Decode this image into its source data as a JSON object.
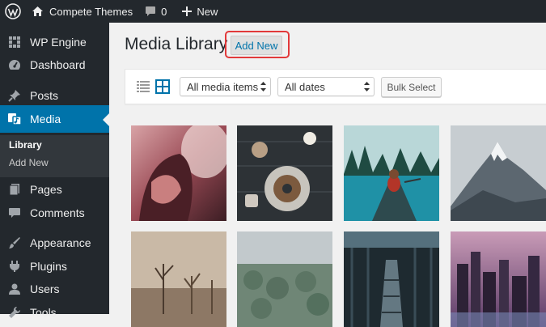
{
  "adminbar": {
    "site_name": "Compete Themes",
    "comments_count": "0",
    "new_label": "New"
  },
  "sidebar": {
    "items": [
      {
        "label": "WP Engine",
        "icon": "wp-engine-icon"
      },
      {
        "label": "Dashboard",
        "icon": "dashboard-icon"
      },
      {
        "label": "Posts",
        "icon": "pin-icon"
      },
      {
        "label": "Media",
        "icon": "media-icon",
        "active": true
      },
      {
        "label": "Pages",
        "icon": "pages-icon"
      },
      {
        "label": "Comments",
        "icon": "comments-icon"
      },
      {
        "label": "Appearance",
        "icon": "brush-icon"
      },
      {
        "label": "Plugins",
        "icon": "plugin-icon"
      },
      {
        "label": "Users",
        "icon": "user-icon"
      },
      {
        "label": "Tools",
        "icon": "wrench-icon"
      }
    ],
    "submenu": [
      {
        "label": "Library",
        "current": true
      },
      {
        "label": "Add New"
      }
    ]
  },
  "main": {
    "title": "Media Library",
    "add_new_label": "Add New",
    "filters": {
      "media_type": "All media items",
      "dates": "All dates"
    },
    "bulk_select_label": "Bulk Select"
  },
  "media_items": [
    {
      "subject": "woman with red hair"
    },
    {
      "subject": "coffee and donut on table"
    },
    {
      "subject": "woman in canoe on lake"
    },
    {
      "subject": "snowy mountain peak"
    },
    {
      "subject": "misty dead trees"
    },
    {
      "subject": "aerial city forest"
    },
    {
      "subject": "escalator in station"
    },
    {
      "subject": "city skyline at dusk"
    }
  ],
  "colors": {
    "admin_bg": "#23282d",
    "accent": "#0073aa",
    "highlight": "#e2393a",
    "page_bg": "#f1f1f1"
  }
}
